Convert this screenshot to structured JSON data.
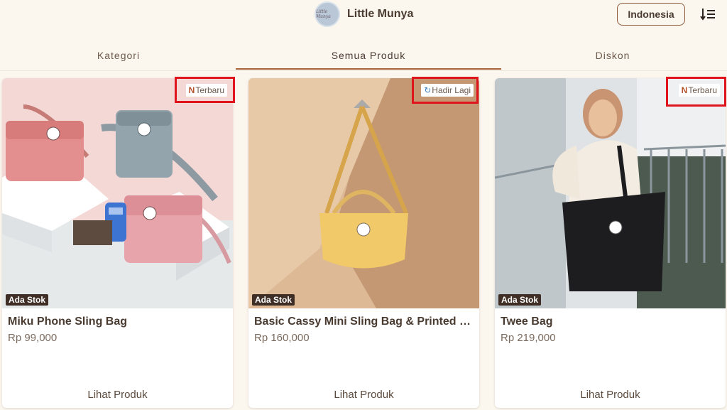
{
  "header": {
    "logo_text": "Little Munya",
    "brand_name": "Little Munya",
    "language_button": "Indonesia",
    "menu_icon": "sort-list-icon"
  },
  "tabs": [
    {
      "label": "Kategori",
      "active": false
    },
    {
      "label": "Semua Produk",
      "active": true
    },
    {
      "label": "Diskon",
      "active": false
    }
  ],
  "products": [
    {
      "badge_icon": "N",
      "badge": "Terbaru",
      "stock": "Ada Stok",
      "name": "Miku Phone Sling Bag",
      "price": "Rp 99,000",
      "cta": "Lihat Produk"
    },
    {
      "badge_icon": "↻",
      "badge": "Hadir Lagi",
      "stock": "Ada Stok",
      "name": "Basic Cassy Mini Sling Bag & Printed C...",
      "price": "Rp 160,000",
      "cta": "Lihat Produk"
    },
    {
      "badge_icon": "N",
      "badge": "Terbaru",
      "stock": "Ada Stok",
      "name": "Twee Bag",
      "price": "Rp 219,000",
      "cta": "Lihat Produk"
    }
  ],
  "colors": {
    "background": "#fbf6ee",
    "accent": "#a8643a",
    "highlight": "#e0141c",
    "stock_badge": "#3f2e25"
  }
}
